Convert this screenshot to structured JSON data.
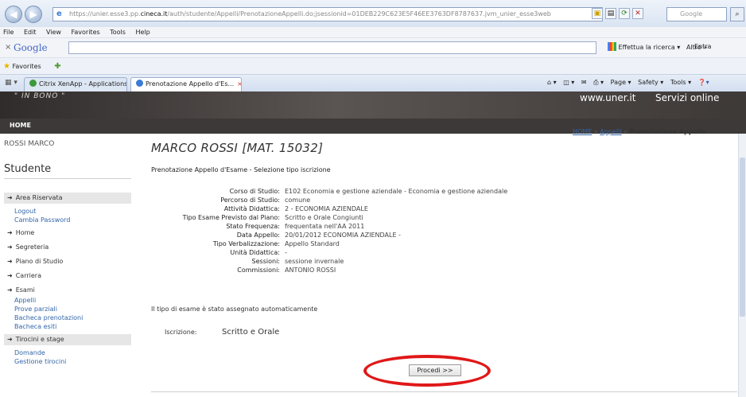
{
  "browser": {
    "url_scheme": "https://",
    "url_host_prefix": "unier.esse3.pp.",
    "url_host": "cineca.it",
    "url_path": "/auth/studente/Appelli/PrenotazioneAppelli.do;jsessionid=01DEB229C623E5F46EE3763DF8787637.jvm_unier_esse3web",
    "search_placeholder": "Google",
    "menu": [
      "File",
      "Edit",
      "View",
      "Favorites",
      "Tools",
      "Help"
    ],
    "google_label": "Google",
    "google_search_label": "Effettua la ricerca",
    "google_more": "Altro »",
    "google_signin": "Entra",
    "favorites_label": "Favorites",
    "tabs": [
      {
        "title": "Citrix XenApp - Applications"
      },
      {
        "title": "Prenotazione Appello d'Es..."
      }
    ],
    "commands": [
      "Page ▾",
      "Safety ▾",
      "Tools ▾"
    ]
  },
  "site": {
    "motto": "\" IN BONO \"",
    "url_label": "www.uner.it",
    "services_label": "Servizi online",
    "home_label": "HOME"
  },
  "sidebar": {
    "user": "ROSSI MARCO",
    "role": "Studente",
    "sections": [
      {
        "label": "Area Riservata",
        "highlight": true,
        "links": [
          "Logout",
          "Cambia Password"
        ]
      },
      {
        "label": "Home",
        "highlight": false,
        "links": []
      },
      {
        "label": "Segreteria",
        "highlight": false,
        "links": []
      },
      {
        "label": "Piano di Studio",
        "highlight": false,
        "links": []
      },
      {
        "label": "Carriera",
        "highlight": false,
        "links": []
      },
      {
        "label": "Esami",
        "highlight": false,
        "links": [
          "Appelli",
          "Prove parziali",
          "Bacheca prenotazioni",
          "Bacheca esiti"
        ]
      },
      {
        "label": "Tirocini e stage",
        "highlight": true,
        "links": [
          "Domande",
          "Gestione tirocini"
        ]
      }
    ]
  },
  "breadcrumb": {
    "home": "HOME",
    "sep": "»",
    "appelli": "Appelli",
    "current": "Prenotazione Appello"
  },
  "main": {
    "student_title": "MARCO ROSSI [MAT. 15032]",
    "subtitle": "Prenotazione Appello d'Esame - Selezione tipo iscrizione",
    "details": [
      {
        "key": "Corso di Studio:",
        "value": "E102 Economia e gestione aziendale - Economia e gestione aziendale"
      },
      {
        "key": "Percorso di Studio:",
        "value": "comune"
      },
      {
        "key": "Attività Didattica:",
        "value": "2 - ECONOMIA AZIENDALE"
      },
      {
        "key": "Tipo Esame Previsto dal Piano:",
        "value": "Scritto e Orale Congiunti"
      },
      {
        "key": "Stato Frequenza:",
        "value": "frequentata nell'AA 2011"
      },
      {
        "key": "Data Appello:",
        "value": "20/01/2012 ECONOMIA AZIENDALE -"
      },
      {
        "key": "Tipo Verbalizzazione:",
        "value": "Appello Standard"
      },
      {
        "key": "Unità Didattica:",
        "value": "-"
      },
      {
        "key": "Sessioni:",
        "value": "sessione invernale"
      },
      {
        "key": "Commissioni:",
        "value": "ANTONIO ROSSI"
      }
    ],
    "auto_note": "Il tipo di esame è stato assegnato automaticamente",
    "iscrizione_label": "Iscrizione:",
    "iscrizione_value": "Scritto e Orale",
    "proceed_button": "Procedi >>"
  },
  "colors": {
    "link": "#3466a8",
    "header_dark": "#3d3938",
    "highlight_circle": "#e01818"
  }
}
